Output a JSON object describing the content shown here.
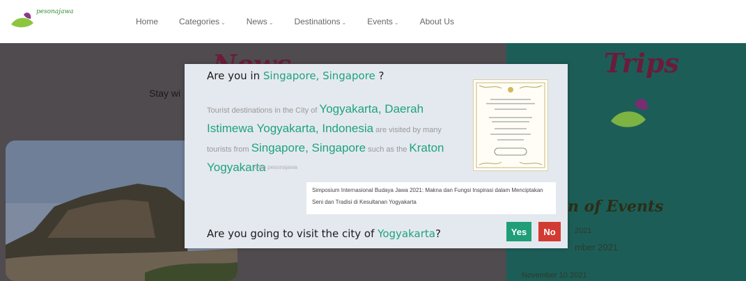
{
  "header": {
    "logo_text": "pesonajawa",
    "nav": [
      {
        "label": "Home",
        "dropdown": false
      },
      {
        "label": "Categories",
        "dropdown": true
      },
      {
        "label": "News",
        "dropdown": true
      },
      {
        "label": "Destinations",
        "dropdown": true
      },
      {
        "label": "Events",
        "dropdown": true
      },
      {
        "label": "About Us",
        "dropdown": false
      }
    ]
  },
  "background": {
    "left_title": "News",
    "left_subtitle": "Stay wi",
    "right_title": "Trips",
    "events_title": "n of Events",
    "event_dates": [
      "2021",
      "mber 2021",
      "November 10 2021"
    ]
  },
  "modal": {
    "question_prefix": "Are you in ",
    "location": "Singapore, Singapore",
    "question_suffix": " ?",
    "text_1": "Tourist destinations in the City of ",
    "city_full": "Yogyakarta, Daerah Istimewa Yogyakarta, Indonesia",
    "text_2": " are visited by many tourists from ",
    "location_big": "Singapore, Singapore",
    "text_3": " such as the ",
    "attraction": "Kraton Yogyakarta",
    "credit": "Oleh pesonajawa",
    "note": "Simposium Internasional Budaya Jawa 2021: Makna dan Fungsi Inspirasi dalam Menciptakan Seni dan Tradisi di Kesultanan Yogyakarta",
    "visit_prefix": "Are you going to visit the city of ",
    "visit_city": "Yogyakarta",
    "visit_suffix": "?",
    "yes_label": "Yes",
    "no_label": "No"
  },
  "colors": {
    "accent": "#1fa27e",
    "yes_button": "#1f9e78",
    "no_button": "#d23b32",
    "trips_panel": "#1d5d58",
    "title_maroon": "#6a1c3a"
  }
}
